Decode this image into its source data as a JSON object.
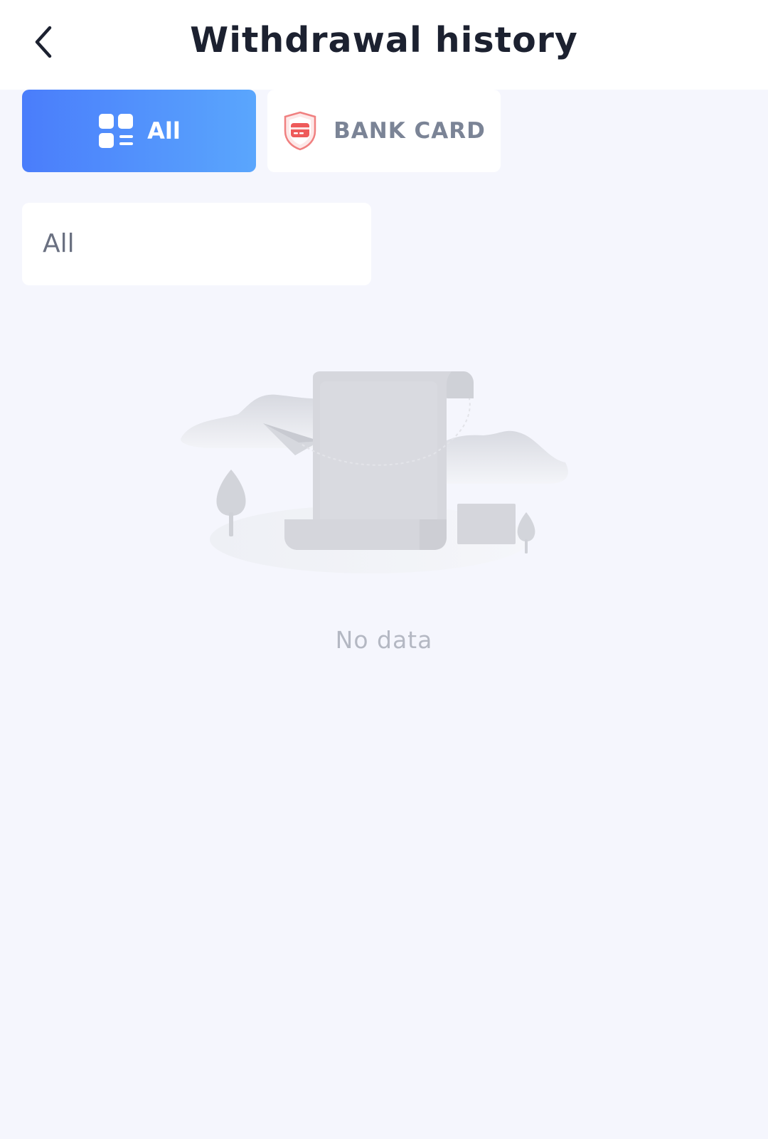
{
  "header": {
    "title": "Withdrawal history",
    "back_icon": "chevron-left-icon"
  },
  "tabs": [
    {
      "label": "All",
      "icon": "grid-list-icon",
      "active": true
    },
    {
      "label": "BANK CARD",
      "icon": "shield-card-icon",
      "active": false
    }
  ],
  "filter": {
    "value": "All"
  },
  "empty_state": {
    "icon": "empty-receipt-illustration",
    "text": "No data"
  },
  "colors": {
    "background": "#f5f6fd",
    "tab_active_start": "#4a7dfb",
    "tab_active_end": "#5aa6fd",
    "bank_icon": "#ee5a5a",
    "title": "#1c2130",
    "muted": "#b4b8c3"
  }
}
